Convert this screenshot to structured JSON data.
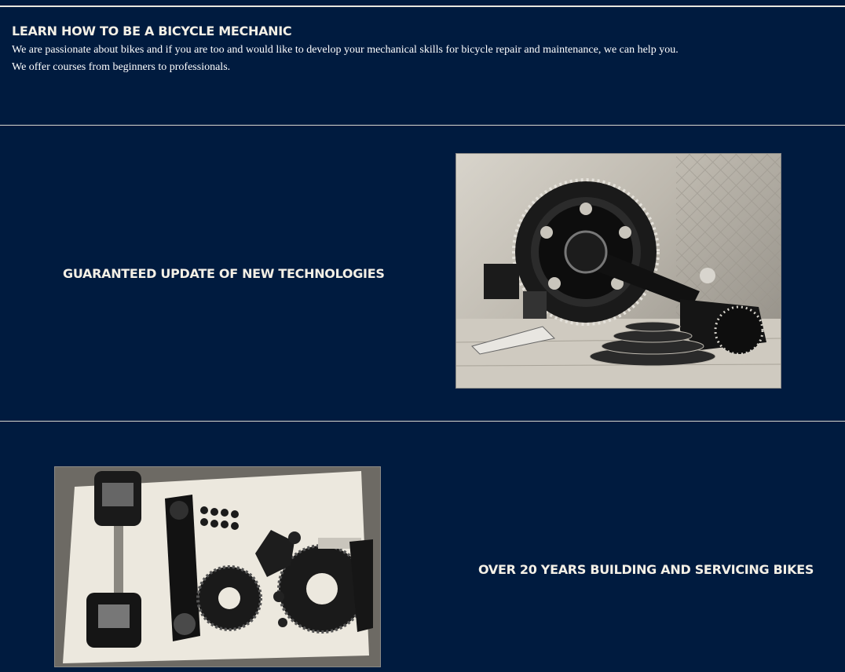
{
  "intro": {
    "title": "LEARN HOW TO BE A BICYCLE MECHANIC",
    "paragraph_1": "We are passionate about bikes and if you are too and would like to develop your mechanical skills for bicycle repair and maintenance, we can help you.",
    "paragraph_2": "We offer courses from beginners to professionals."
  },
  "features": [
    {
      "title": "GUARANTEED UPDATE OF NEW TECHNOLOGIES",
      "image": "drivetrain-crankset-photo"
    },
    {
      "title": "OVER 20 YEARS BUILDING AND SERVICING BIKES",
      "image": "disassembled-bike-parts-photo"
    }
  ],
  "colors": {
    "background": "#001b3f",
    "heading": "#f4f0e6",
    "body_text": "#ffffff",
    "divider": "#d9d6ce"
  }
}
